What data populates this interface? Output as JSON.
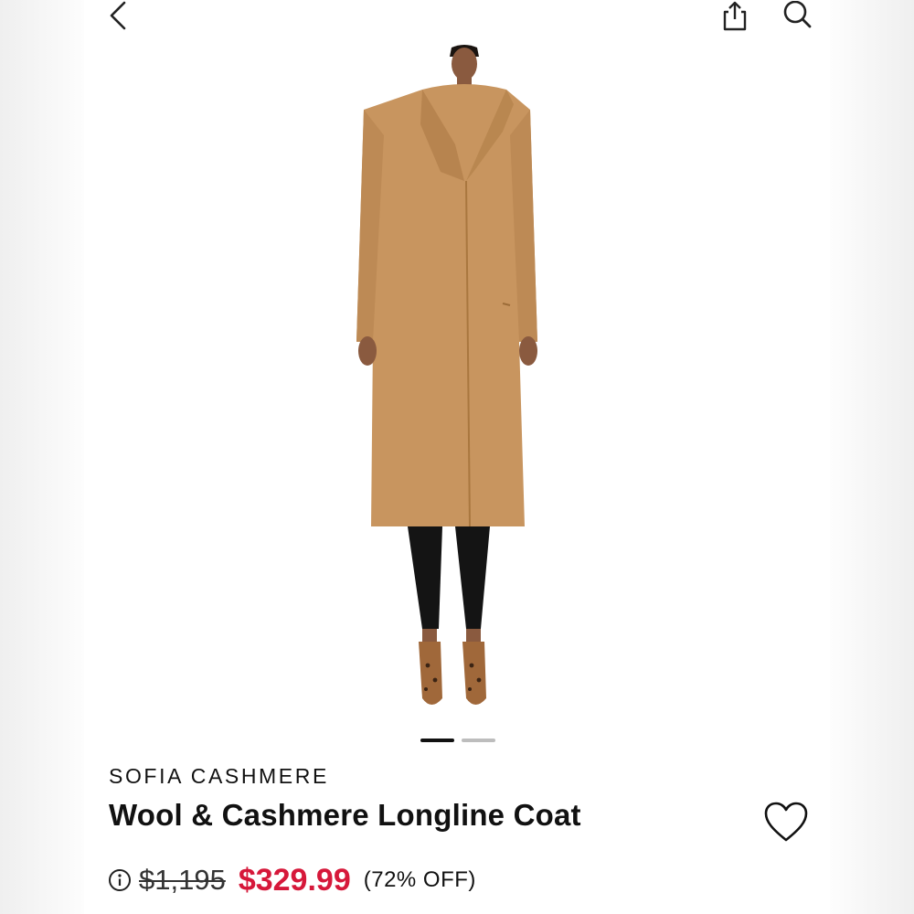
{
  "nav": {
    "back_icon": "chevron-left-icon",
    "share_icon": "share-icon",
    "search_icon": "search-icon"
  },
  "image": {
    "carousel_count": 2,
    "carousel_active": 0
  },
  "product": {
    "brand": "SOFIA CASHMERE",
    "title": "Wool & Cashmere Longline Coat",
    "original_price": "$1,195",
    "sale_price": "$329.99",
    "discount": "(72% OFF)",
    "favorite_icon": "heart-icon",
    "info_icon": "info-icon"
  },
  "colors": {
    "sale_price": "#d6183a",
    "coat": "#c8955f"
  }
}
